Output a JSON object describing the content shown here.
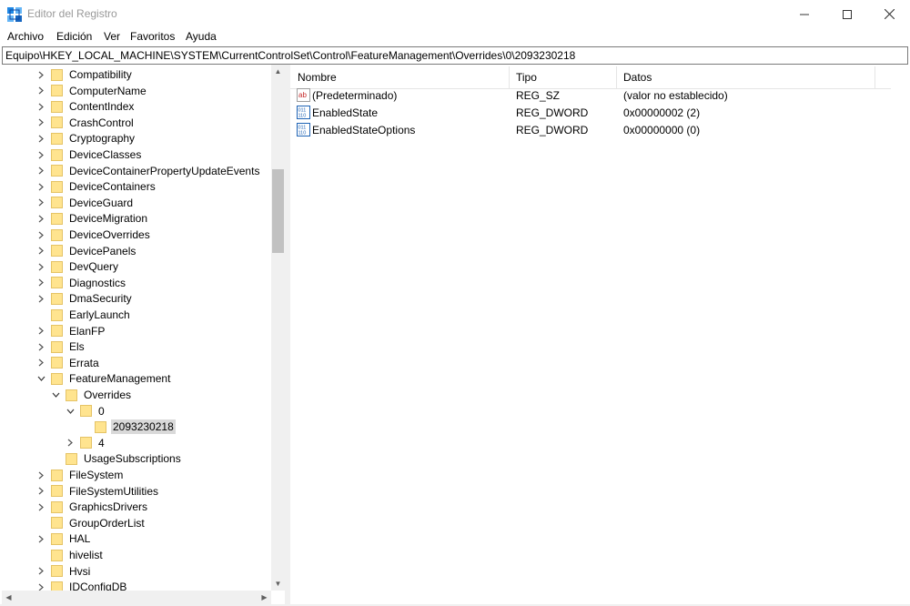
{
  "window": {
    "title": "Editor del Registro",
    "controls": {
      "minimize": "minimize-icon",
      "maximize": "maximize-icon",
      "close": "close-icon"
    }
  },
  "menu": [
    "Archivo",
    "Edición",
    "Ver",
    "Favoritos",
    "Ayuda"
  ],
  "address": "Equipo\\HKEY_LOCAL_MACHINE\\SYSTEM\\CurrentControlSet\\Control\\FeatureManagement\\Overrides\\0\\2093230218",
  "tree": [
    {
      "label": "Compatibility",
      "depth": 0,
      "expander": "collapsed"
    },
    {
      "label": "ComputerName",
      "depth": 0,
      "expander": "collapsed"
    },
    {
      "label": "ContentIndex",
      "depth": 0,
      "expander": "collapsed"
    },
    {
      "label": "CrashControl",
      "depth": 0,
      "expander": "collapsed"
    },
    {
      "label": "Cryptography",
      "depth": 0,
      "expander": "collapsed"
    },
    {
      "label": "DeviceClasses",
      "depth": 0,
      "expander": "collapsed"
    },
    {
      "label": "DeviceContainerPropertyUpdateEvents",
      "depth": 0,
      "expander": "collapsed"
    },
    {
      "label": "DeviceContainers",
      "depth": 0,
      "expander": "collapsed"
    },
    {
      "label": "DeviceGuard",
      "depth": 0,
      "expander": "collapsed"
    },
    {
      "label": "DeviceMigration",
      "depth": 0,
      "expander": "collapsed"
    },
    {
      "label": "DeviceOverrides",
      "depth": 0,
      "expander": "collapsed"
    },
    {
      "label": "DevicePanels",
      "depth": 0,
      "expander": "collapsed"
    },
    {
      "label": "DevQuery",
      "depth": 0,
      "expander": "collapsed"
    },
    {
      "label": "Diagnostics",
      "depth": 0,
      "expander": "collapsed"
    },
    {
      "label": "DmaSecurity",
      "depth": 0,
      "expander": "collapsed"
    },
    {
      "label": "EarlyLaunch",
      "depth": 0,
      "expander": "none"
    },
    {
      "label": "ElanFP",
      "depth": 0,
      "expander": "collapsed"
    },
    {
      "label": "Els",
      "depth": 0,
      "expander": "collapsed"
    },
    {
      "label": "Errata",
      "depth": 0,
      "expander": "collapsed"
    },
    {
      "label": "FeatureManagement",
      "depth": 0,
      "expander": "expanded"
    },
    {
      "label": "Overrides",
      "depth": 1,
      "expander": "expanded"
    },
    {
      "label": "0",
      "depth": 2,
      "expander": "expanded"
    },
    {
      "label": "2093230218",
      "depth": 3,
      "expander": "none",
      "selected": true
    },
    {
      "label": "4",
      "depth": 2,
      "expander": "collapsed"
    },
    {
      "label": "UsageSubscriptions",
      "depth": 1,
      "expander": "none"
    },
    {
      "label": "FileSystem",
      "depth": 0,
      "expander": "collapsed"
    },
    {
      "label": "FileSystemUtilities",
      "depth": 0,
      "expander": "collapsed"
    },
    {
      "label": "GraphicsDrivers",
      "depth": 0,
      "expander": "collapsed"
    },
    {
      "label": "GroupOrderList",
      "depth": 0,
      "expander": "none"
    },
    {
      "label": "HAL",
      "depth": 0,
      "expander": "collapsed"
    },
    {
      "label": "hivelist",
      "depth": 0,
      "expander": "none"
    },
    {
      "label": "Hvsi",
      "depth": 0,
      "expander": "collapsed"
    },
    {
      "label": "IDConfigDB",
      "depth": 0,
      "expander": "collapsed"
    }
  ],
  "list": {
    "columns": [
      "Nombre",
      "Tipo",
      "Datos"
    ],
    "rows": [
      {
        "icon": "string-value-icon",
        "name": "(Predeterminado)",
        "type": "REG_SZ",
        "data": "(valor no establecido)"
      },
      {
        "icon": "binary-value-icon",
        "name": "EnabledState",
        "type": "REG_DWORD",
        "data": "0x00000002 (2)"
      },
      {
        "icon": "binary-value-icon",
        "name": "EnabledStateOptions",
        "type": "REG_DWORD",
        "data": "0x00000000 (0)"
      }
    ]
  }
}
